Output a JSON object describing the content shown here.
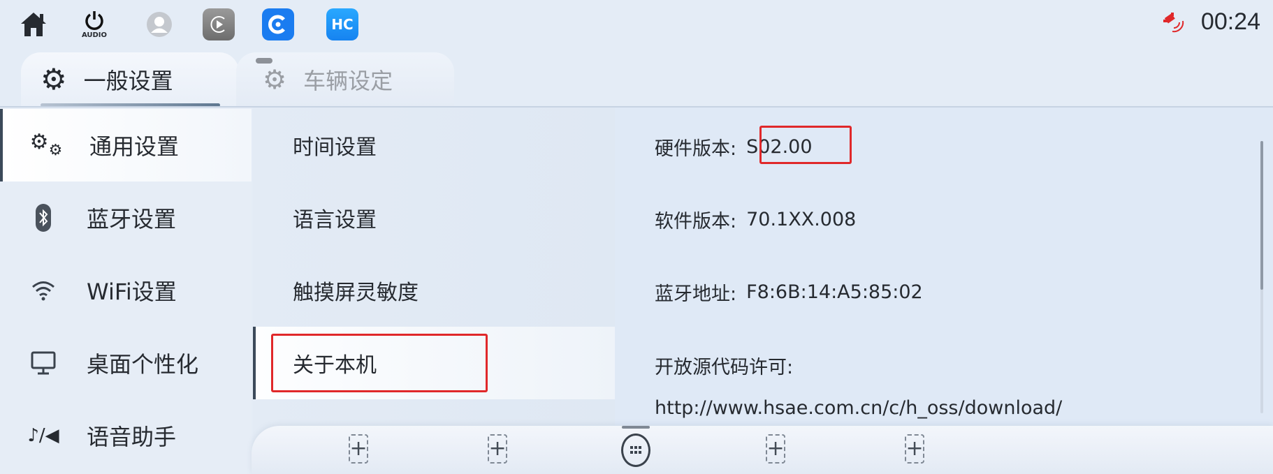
{
  "status_bar": {
    "icons": [
      "home-icon",
      "audio-power-icon",
      "user-avatar-icon",
      "carplay-icon",
      "app-blue-icon",
      "hicar-icon"
    ],
    "audio_label": "AUDIO",
    "hicar_label": "HC",
    "signal_icon": "satellite-signal-icon",
    "time": "00:24",
    "alert_color": "#e0282a"
  },
  "tabs": [
    {
      "label": "一般设置",
      "icon": "gear-icon",
      "active": true
    },
    {
      "label": "车辆设定",
      "icon": "car-gear-icon",
      "active": false
    }
  ],
  "sidebar": {
    "items": [
      {
        "label": "通用设置",
        "icon": "gears-icon",
        "selected": true
      },
      {
        "label": "蓝牙设置",
        "icon": "bluetooth-icon"
      },
      {
        "label": "WiFi设置",
        "icon": "wifi-icon"
      },
      {
        "label": "桌面个性化",
        "icon": "monitor-icon"
      },
      {
        "label": "语音助手",
        "icon": "voice-icon"
      }
    ]
  },
  "submenu": {
    "items": [
      {
        "label": "时间设置"
      },
      {
        "label": "语言设置"
      },
      {
        "label": "触摸屏灵敏度"
      },
      {
        "label": "关于本机",
        "selected": true
      }
    ]
  },
  "about": {
    "hardware_label": "硬件版本:",
    "hardware_value": "S02.00",
    "software_label": "软件版本:",
    "software_value": "70.1XX.008",
    "bt_label": "蓝牙地址:",
    "bt_value": "F8:6B:14:A5:85:02",
    "oss_label": "开放源代码许可:",
    "oss_url": "http://www.hsae.com.cn/c/h_oss/download/"
  },
  "dock": {
    "slots": [
      "+",
      "+",
      "apps",
      "+",
      "+"
    ]
  }
}
